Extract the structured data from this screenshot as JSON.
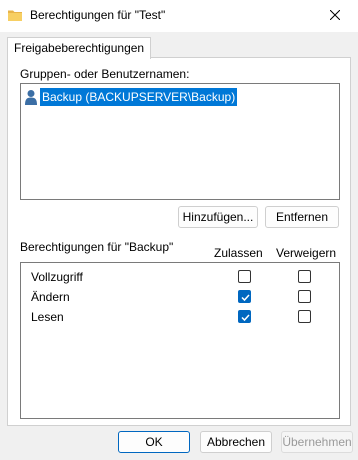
{
  "window": {
    "title": "Berechtigungen für \"Test\""
  },
  "tabs": [
    {
      "label": "Freigabeberechtigungen"
    }
  ],
  "groups": {
    "label": "Gruppen- oder Benutzernamen:",
    "items": [
      {
        "name": "Backup (BACKUPSERVER\\Backup)"
      }
    ],
    "add_label": "Hinzufügen...",
    "remove_label": "Entfernen"
  },
  "permissions": {
    "label": "Berechtigungen für \"Backup\"",
    "allow_header": "Zulassen",
    "deny_header": "Verweigern",
    "rows": [
      {
        "name": "Vollzugriff",
        "allow": false,
        "deny": false
      },
      {
        "name": "Ändern",
        "allow": true,
        "deny": false
      },
      {
        "name": "Lesen",
        "allow": true,
        "deny": false
      }
    ]
  },
  "footer": {
    "ok_label": "OK",
    "cancel_label": "Abbrechen",
    "apply_label": "Übernehmen"
  },
  "colors": {
    "accent": "#0067c0",
    "selection": "#0078d7"
  }
}
